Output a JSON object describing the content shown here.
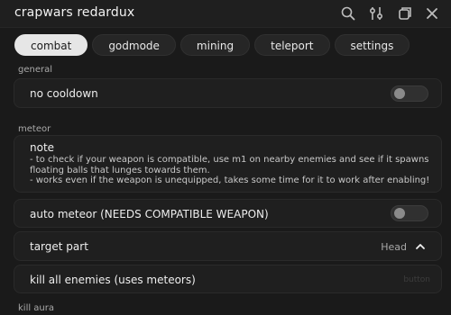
{
  "window": {
    "title": "crapwars redardux"
  },
  "titlebar_icons": [
    "search-icon",
    "settings-sliders-icon",
    "window-toggle-icon",
    "close-icon"
  ],
  "tabs": [
    {
      "label": "combat",
      "active": true
    },
    {
      "label": "godmode",
      "active": false
    },
    {
      "label": "mining",
      "active": false
    },
    {
      "label": "teleport",
      "active": false
    },
    {
      "label": "settings",
      "active": false
    }
  ],
  "sections": {
    "general": "general",
    "meteor": "meteor",
    "kill_aura": "kill aura"
  },
  "general": {
    "no_cooldown": {
      "label": "no cooldown",
      "enabled": false
    }
  },
  "meteor": {
    "note": {
      "title": "note",
      "lines": [
        "- to check if your weapon is compatible, use m1 on nearby enemies and see if it spawns floating balls that lunges towards them.",
        "- works even if the weapon is unequipped, takes some time for it to work after enabling!"
      ]
    },
    "auto_meteor": {
      "label": "auto meteor (NEEDS COMPATIBLE WEAPON)",
      "enabled": false
    },
    "target_part": {
      "label": "target part",
      "value": "Head"
    },
    "kill_all": {
      "label": "kill all enemies (uses meteors)",
      "hint": "button"
    }
  },
  "colors": {
    "background": "#1a1a1a",
    "card": "#1f1f1f",
    "active_tab": "#e6e6e6",
    "toggle_off": "#303030"
  }
}
